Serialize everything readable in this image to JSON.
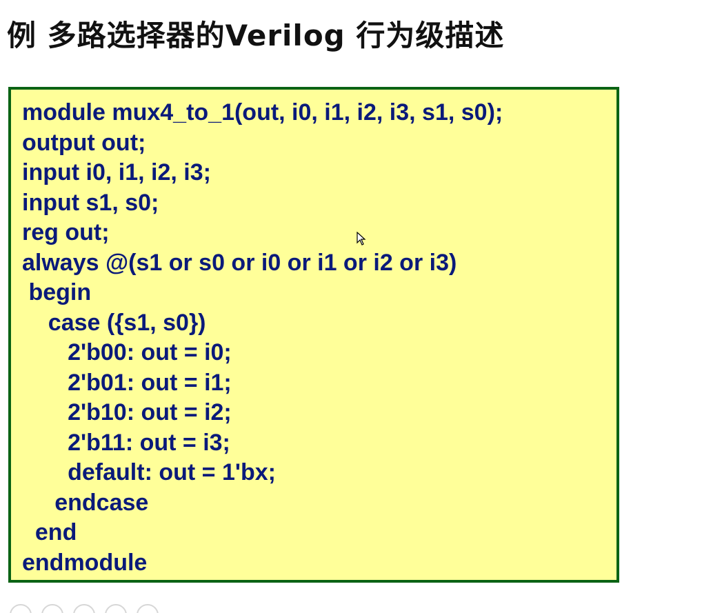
{
  "title": "例  多路选择器的Verilog 行为级描述",
  "code": {
    "lines": [
      "module mux4_to_1(out, i0, i1, i2, i3, s1, s0);",
      "output out;",
      "input i0, i1, i2, i3;",
      "input s1, s0;",
      "reg out;",
      "always @(s1 or s0 or i0 or i1 or i2 or i3)",
      " begin",
      "    case ({s1, s0})",
      "       2'b00: out = i0;",
      "       2'b01: out = i1;",
      "       2'b10: out = i2;",
      "       2'b11: out = i3;",
      "       default: out = 1'bx;",
      "     endcase",
      "  end",
      "endmodule"
    ]
  },
  "colors": {
    "code_background": "#ffff99",
    "code_border": "#0b6314",
    "code_text": "#0a1a7a",
    "title_text": "#111111"
  },
  "icons": {
    "cursor": "mouse-pointer-icon"
  }
}
